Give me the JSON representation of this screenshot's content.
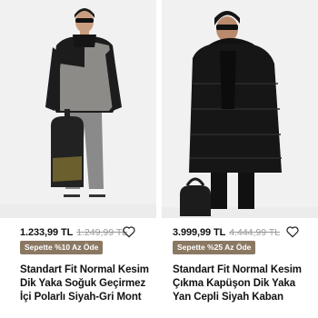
{
  "products": [
    {
      "price": "1.233,99 TL",
      "old_price": "1.249,99 TL",
      "badge": "Sepette %10 Az Öde",
      "title": "Standart Fit Normal Kesim Dik Yaka Soğuk Geçirmez İçi Polarlı Siyah-Gri Mont",
      "favorite_icon": "heart-outline-icon"
    },
    {
      "price": "3.999,99 TL",
      "old_price": "4.444,99 TL",
      "badge": "Sepette %25 Az Öde",
      "title": "Standart Fit Normal Kesim Çıkma Kapüşon Dik Yaka Yan Cepli Siyah Kaban",
      "favorite_icon": "heart-outline-icon"
    }
  ],
  "colors": {
    "badge_bg": "#8b7863",
    "old_price": "#9a9a9a",
    "photo_bg": "#f2f2f2"
  }
}
